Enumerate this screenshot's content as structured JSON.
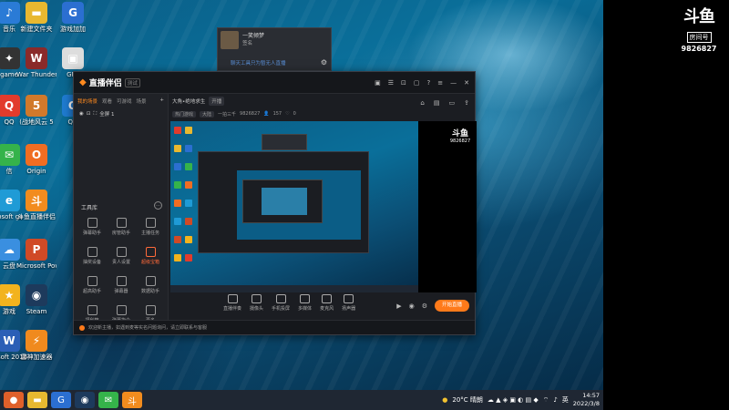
{
  "desktop": {
    "icons": [
      {
        "label": "音乐",
        "icon": "music-icon",
        "color": "#2a7bd6",
        "glyph": "♪"
      },
      {
        "label": "新建文件夹",
        "icon": "folder-icon",
        "color": "#e8b830",
        "glyph": "▬"
      },
      {
        "label": "游戏加加",
        "icon": "game-plus-icon",
        "color": "#2b6fd1",
        "glyph": "G"
      },
      {
        "label": "game",
        "icon": "game-icon",
        "color": "#333",
        "glyph": "✦"
      },
      {
        "label": "War Thunder",
        "icon": "war-thunder-icon",
        "color": "#8a2a2a",
        "glyph": "W"
      },
      {
        "label": "GPP",
        "icon": "gpp-icon",
        "color": "#ddd",
        "glyph": "▣"
      },
      {
        "label": "QQ",
        "icon": "qq-icon",
        "color": "#e23b2c",
        "glyph": "Q"
      },
      {
        "label": "(战地风云 5",
        "icon": "battlefield-icon",
        "color": "#d1792b",
        "glyph": "5"
      },
      {
        "label": "QQ",
        "icon": "qq-icon-2",
        "color": "#1f7bd1",
        "glyph": "Q"
      },
      {
        "label": "信",
        "icon": "wechat-icon",
        "color": "#35b34a",
        "glyph": "✉"
      },
      {
        "label": "Origin",
        "icon": "origin-icon",
        "color": "#f06d22",
        "glyph": "O"
      },
      {
        "label": "rosoft ge",
        "icon": "edge-icon",
        "color": "#1f9bd6",
        "glyph": "e"
      },
      {
        "label": "斗鱼直播伴侣",
        "icon": "douyu-companion-icon",
        "color": "#f28c1e",
        "glyph": "斗"
      },
      {
        "label": "云盘",
        "icon": "cloud-drive-icon",
        "color": "#3a8fe0",
        "glyph": "☁"
      },
      {
        "label": "Microsoft PowerPoi...",
        "icon": "powerpoint-icon",
        "color": "#d04a26",
        "glyph": "P"
      },
      {
        "label": "游戏",
        "icon": "games-folder-icon",
        "color": "#f2b31e",
        "glyph": "★"
      },
      {
        "label": "Steam",
        "icon": "steam-icon",
        "color": "#1d3a5c",
        "glyph": "◉"
      },
      {
        "label": "rosoft 2016",
        "icon": "office-icon",
        "color": "#2b5fb6",
        "glyph": "W"
      },
      {
        "label": "雷神加速器",
        "icon": "leishen-accelerator-icon",
        "color": "#f08a1e",
        "glyph": "⚡"
      }
    ]
  },
  "popup": {
    "name": "一笑倾梦",
    "subtitle": "签名",
    "link": "聊天工具只为暂无人直播",
    "badge": "房间号 ?"
  },
  "right_logo": {
    "mark": "斗鱼",
    "tag": "房间号",
    "room_number": "9826827"
  },
  "app": {
    "logo": "直播伴侣",
    "version": "测试",
    "left_tabs": [
      "我的场景",
      "观看",
      "可游戏",
      "场景"
    ],
    "scene_name": "全屏 1",
    "tools_title": "工具库",
    "tools": [
      {
        "label": "弹幕助手",
        "icon": "danmaku-icon"
      },
      {
        "label": "房管助手",
        "icon": "admin-icon"
      },
      {
        "label": "主播任务",
        "icon": "task-icon"
      },
      {
        "label": "抽奖设备",
        "icon": "lottery-icon"
      },
      {
        "label": "贵人设置",
        "icon": "vip-icon"
      },
      {
        "label": "超级宝箱",
        "icon": "treasure-icon",
        "on": true
      },
      {
        "label": "超高助手",
        "icon": "boost-icon"
      },
      {
        "label": "弹幕器",
        "icon": "danmaku-tool-icon"
      },
      {
        "label": "数据助手",
        "icon": "data-icon"
      },
      {
        "label": "福利箱",
        "icon": "gift-icon"
      },
      {
        "label": "弹幕指令",
        "icon": "command-icon"
      },
      {
        "label": "更多",
        "icon": "more-icon"
      }
    ],
    "room_title": "大角•绝地求生",
    "room_chip": "开播",
    "category": "热门游戏",
    "sub_category": "大陆",
    "host": "一拍三千",
    "room_id": "9826827",
    "viewers": "157",
    "followers": "0",
    "bottom_tools": [
      {
        "label": "直播伴奏",
        "icon": "music-accompany-icon"
      },
      {
        "label": "摄像头",
        "icon": "camera-icon"
      },
      {
        "label": "手机投屏",
        "icon": "phone-cast-icon"
      },
      {
        "label": "多媒体",
        "icon": "media-icon"
      },
      {
        "label": "麦克风",
        "icon": "microphone-icon"
      },
      {
        "label": "扬声器",
        "icon": "speaker-icon"
      }
    ],
    "live_button": "开始直播",
    "stats": [
      "帧率(FPS):0",
      "码率:0kb",
      "CPU:0%",
      "内存:0%",
      "00:00:00"
    ],
    "status_text": "欢迎新主播，如遇到麦等实名问题询问，请立即联系与客服"
  },
  "taskbar": {
    "weather": "20°C 晴朗",
    "time": "14:57",
    "date": "2022/3/8",
    "ime": "英"
  }
}
